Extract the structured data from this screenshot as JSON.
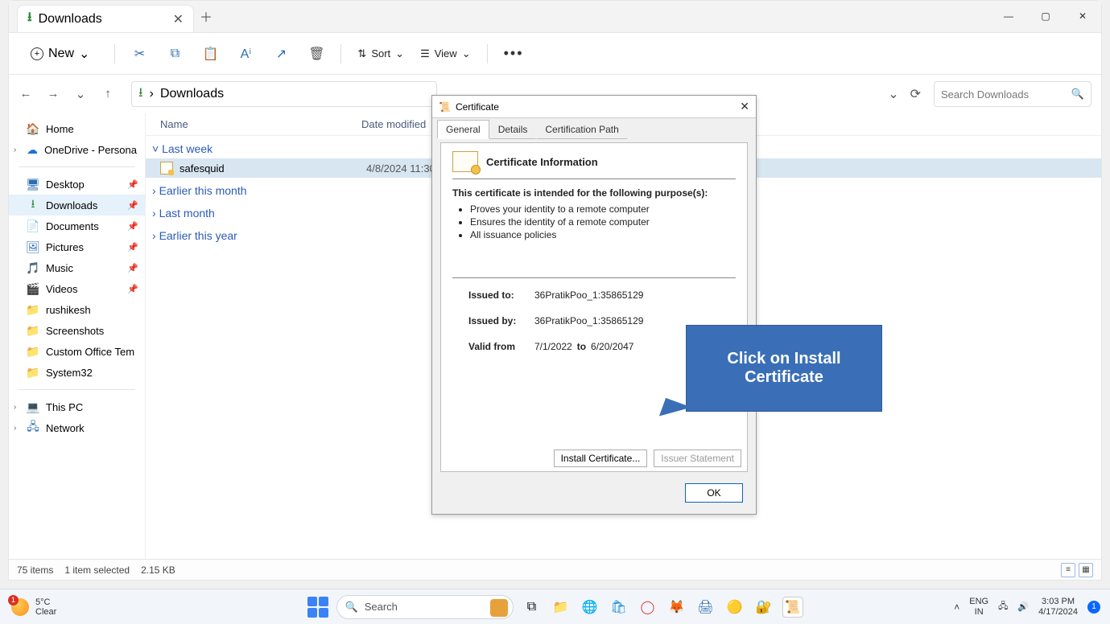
{
  "explorer": {
    "tab_title": "Downloads",
    "toolbar": {
      "new": "New",
      "sort": "Sort",
      "view": "View"
    },
    "breadcrumb": "Downloads",
    "search_placeholder": "Search Downloads",
    "columns": {
      "name": "Name",
      "date": "Date modified"
    },
    "sidebar": {
      "home": "Home",
      "onedrive": "OneDrive - Persona",
      "quick": [
        "Desktop",
        "Downloads",
        "Documents",
        "Pictures",
        "Music",
        "Videos",
        "rushikesh",
        "Screenshots",
        "Custom Office Tem",
        "System32"
      ],
      "this_pc": "This PC",
      "network": "Network"
    },
    "groups": {
      "last_week": "Last week",
      "earlier_month": "Earlier this month",
      "last_month": "Last month",
      "earlier_year": "Earlier this year"
    },
    "file": {
      "name": "safesquid",
      "date": "4/8/2024 11:30 A"
    },
    "status": {
      "count": "75 items",
      "sel": "1 item selected",
      "size": "2.15 KB"
    }
  },
  "cert": {
    "title": "Certificate",
    "tabs": {
      "general": "General",
      "details": "Details",
      "path": "Certification Path"
    },
    "heading": "Certificate Information",
    "intended": "This certificate is intended for the following purpose(s):",
    "bullets": [
      "Proves your identity to a remote computer",
      "Ensures the identity of a remote computer",
      "All issuance policies"
    ],
    "issued_to_l": "Issued to:",
    "issued_to_v": "36PratikPoo_1:35865129",
    "issued_by_l": "Issued by:",
    "issued_by_v": "36PratikPoo_1:35865129",
    "valid_from_l": "Valid from",
    "valid_from_v": "7/1/2022",
    "valid_to_l": "to",
    "valid_to_v": "6/20/2047",
    "install_btn": "Install Certificate...",
    "issuer_btn": "Issuer Statement",
    "ok": "OK"
  },
  "callout": "Click on Install Certificate",
  "taskbar": {
    "weather_temp": "5°C",
    "weather_cond": "Clear",
    "weather_badge": "1",
    "search": "Search",
    "lang1": "ENG",
    "lang2": "IN",
    "time": "3:03 PM",
    "date": "4/17/2024",
    "notif": "1"
  }
}
